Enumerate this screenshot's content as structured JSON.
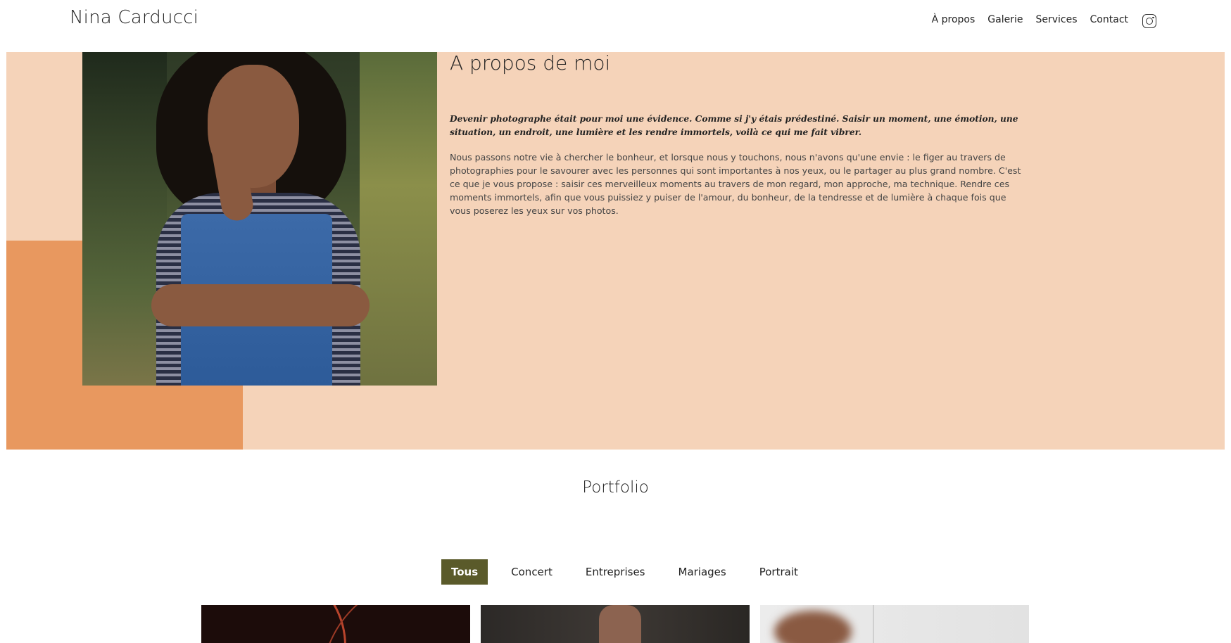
{
  "header": {
    "brand": "Nina Carducci",
    "nav": [
      "À propos",
      "Galerie",
      "Services",
      "Contact"
    ],
    "social_icon": "instagram-icon"
  },
  "about": {
    "title": "A propos de moi",
    "quote": "Devenir photographe était pour moi une évidence. Comme si j'y étais prédestiné. Saisir un moment, une émotion, une situation, un endroit, une lumière et les rendre immortels, voilà ce qui me fait vibrer.",
    "body": "Nous passons notre vie à chercher le bonheur, et lorsque nous y touchons, nous n'avons qu'une envie : le figer au travers de photographies pour le savourer avec les personnes qui sont importantes à nos yeux, ou le partager au plus grand nombre. C'est ce que je vous propose : saisir ces merveilleux moments au travers de mon regard, mon approche, ma technique. Rendre ces moments immortels, afin que vous puissiez y puiser de l'amour, du bonheur, de la tendresse et de lumière à chaque fois que vous poserez les yeux sur vos photos.",
    "colors": {
      "background": "#f5d3b9",
      "accent_block": "#e8985f"
    }
  },
  "portfolio": {
    "title": "Portfolio",
    "filters": [
      "Tous",
      "Concert",
      "Entreprises",
      "Mariages",
      "Portrait"
    ],
    "active_filter": "Tous",
    "active_color": "#5a5a2a"
  }
}
